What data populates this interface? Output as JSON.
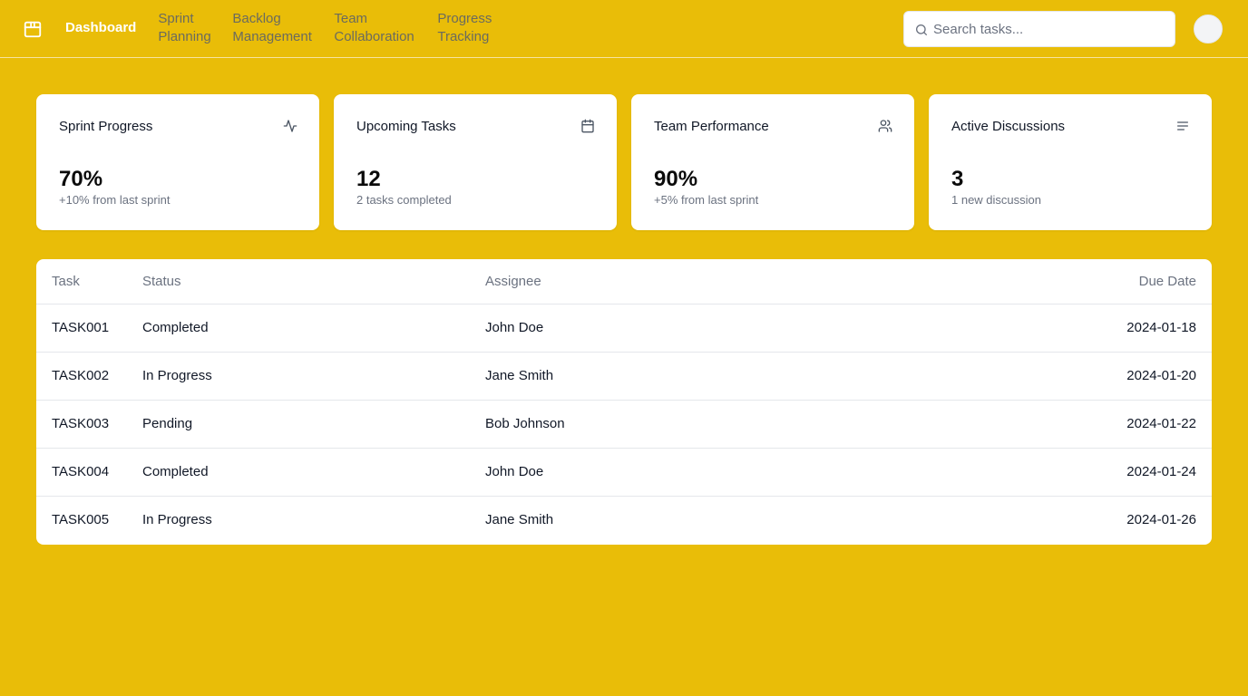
{
  "nav": {
    "items": [
      {
        "label": "Dashboard",
        "active": true
      },
      {
        "label": "Sprint Planning"
      },
      {
        "label": "Backlog Management"
      },
      {
        "label": "Team Collaboration"
      },
      {
        "label": "Progress Tracking"
      }
    ]
  },
  "search": {
    "placeholder": "Search tasks...",
    "icon": "search-icon"
  },
  "cards": [
    {
      "title": "Sprint Progress",
      "value": "70%",
      "sub": "+10% from last sprint",
      "icon": "activity-icon"
    },
    {
      "title": "Upcoming Tasks",
      "value": "12",
      "sub": "2 tasks completed",
      "icon": "calendar-icon"
    },
    {
      "title": "Team Performance",
      "value": "90%",
      "sub": "+5% from last sprint",
      "icon": "users-icon"
    },
    {
      "title": "Active Discussions",
      "value": "3",
      "sub": "1 new discussion",
      "icon": "lines-icon"
    }
  ],
  "table": {
    "headers": [
      "Task",
      "Status",
      "Assignee",
      "Due Date"
    ],
    "rows": [
      [
        "TASK001",
        "Completed",
        "John Doe",
        "2024-01-18"
      ],
      [
        "TASK002",
        "In Progress",
        "Jane Smith",
        "2024-01-20"
      ],
      [
        "TASK003",
        "Pending",
        "Bob Johnson",
        "2024-01-22"
      ],
      [
        "TASK004",
        "Completed",
        "John Doe",
        "2024-01-24"
      ],
      [
        "TASK005",
        "In Progress",
        "Jane Smith",
        "2024-01-26"
      ]
    ]
  },
  "colors": {
    "background": "#e9bd08",
    "card": "#ffffff",
    "muted": "#6b7280"
  }
}
